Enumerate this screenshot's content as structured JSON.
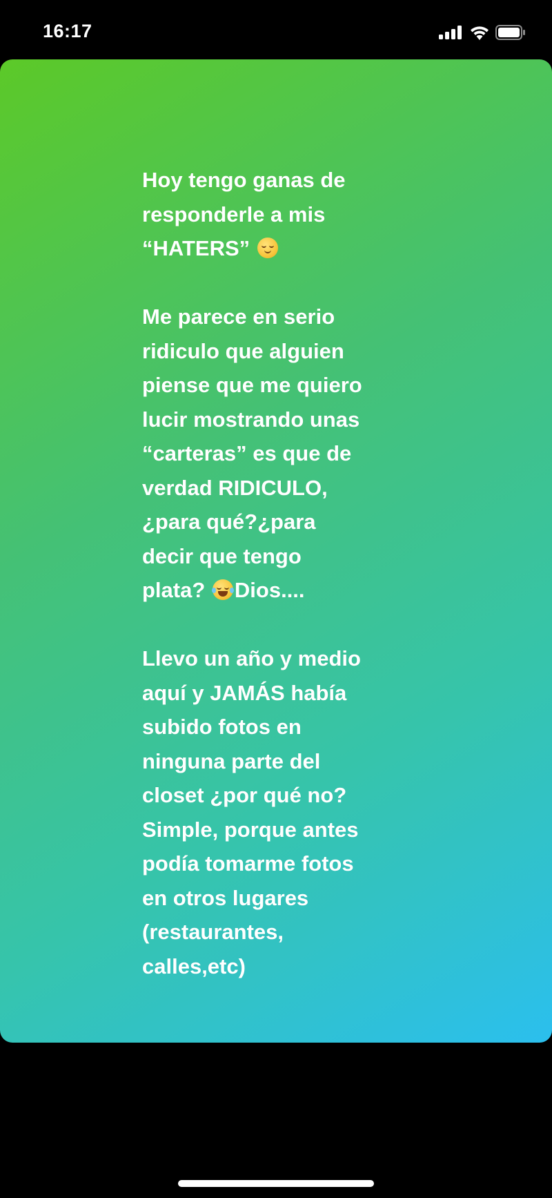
{
  "status_bar": {
    "time": "16:17",
    "icons": [
      "signal-icon",
      "wifi-icon",
      "battery-icon"
    ]
  },
  "story": {
    "background_colors": [
      "#5cc928",
      "#45c173",
      "#36c4ab",
      "#2bbfee"
    ],
    "paragraph1": {
      "line1": "Hoy tengo ganas de",
      "line2": "responderle a mis",
      "line3": "“HATERS” ",
      "emoji": "relieved-face"
    },
    "paragraph2": {
      "line1": "Me parece en serio",
      "line2": "ridiculo que alguien",
      "line3": "piense que me quiero",
      "line4": "lucir mostrando unas",
      "line5": "“carteras” es que de",
      "line6": "verdad RIDICULO,",
      "line7": "¿para qué?¿para",
      "line8": "decir que tengo",
      "line9_before": "plata? ",
      "emoji": "face-with-tears-of-joy",
      "line9_after": "Dios...."
    },
    "paragraph3": {
      "line1": "Llevo un año y medio",
      "line2": "aquí y JAMÁS había",
      "line3": "subido fotos en",
      "line4": "ninguna parte del",
      "line5": "closet ¿por qué no?",
      "line6": "Simple, porque antes",
      "line7": "podía tomarme fotos",
      "line8": "en otros lugares",
      "line9": "(restaurantes,",
      "line10": "calles,etc)"
    }
  }
}
